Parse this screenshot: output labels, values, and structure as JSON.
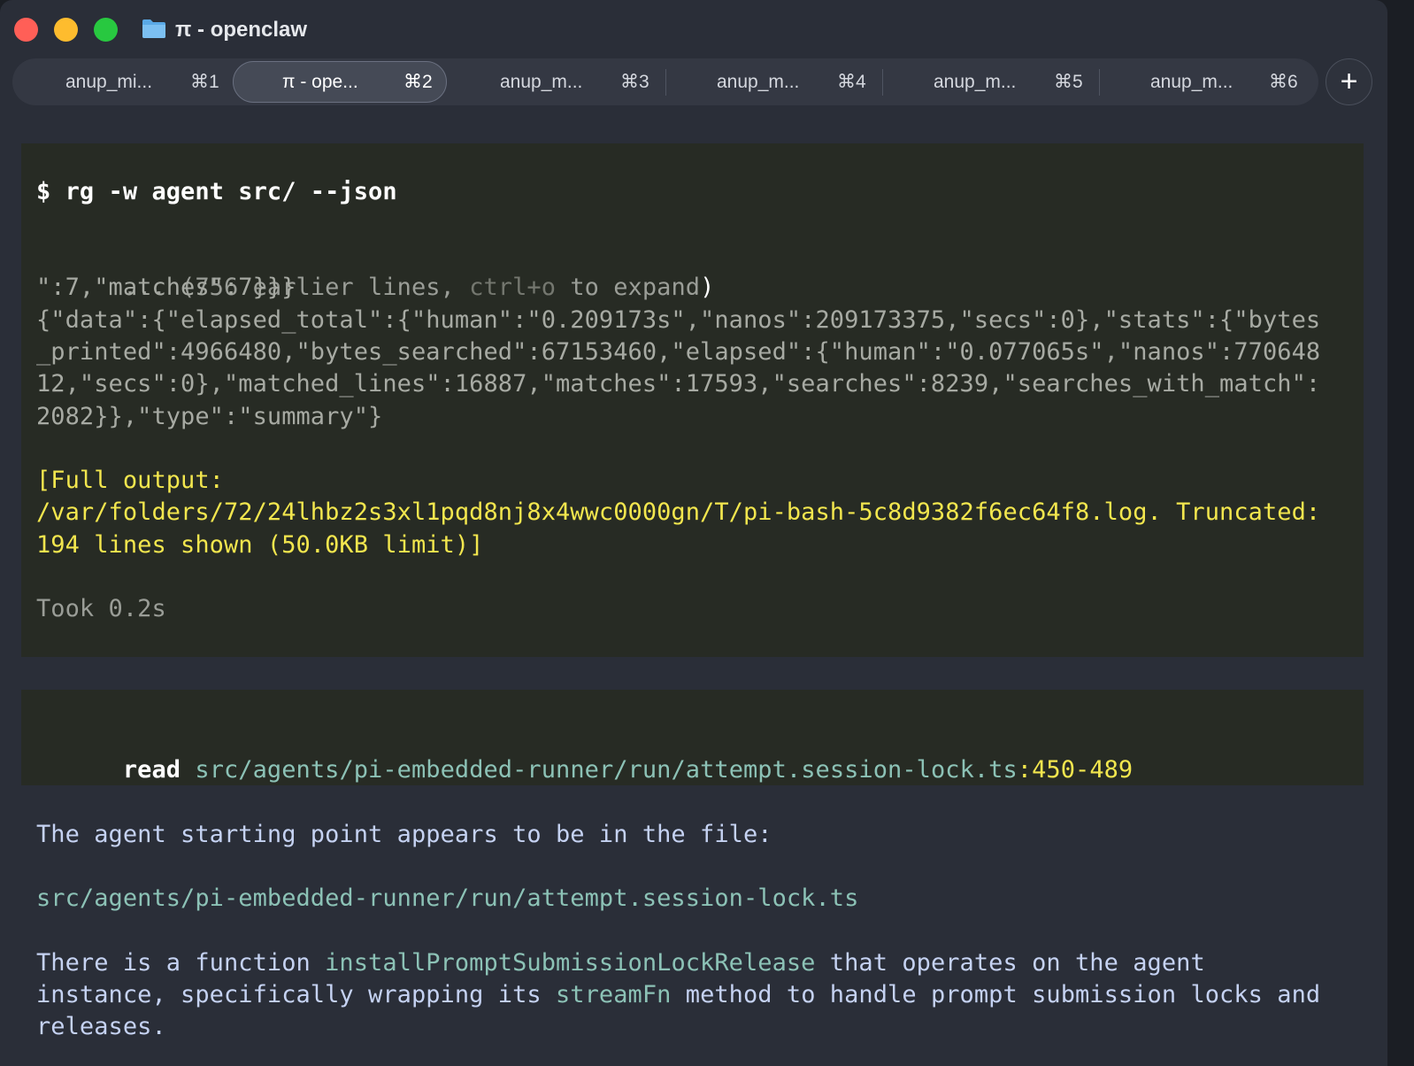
{
  "window": {
    "title": "π - openclaw",
    "folder_icon": "folder-icon"
  },
  "tabs": [
    {
      "label": "anup_mi...",
      "key": "⌘1",
      "active": false
    },
    {
      "label": "π - ope...",
      "key": "⌘2",
      "active": true
    },
    {
      "label": "anup_m...",
      "key": "⌘3",
      "active": false
    },
    {
      "label": "anup_m...",
      "key": "⌘4",
      "active": false
    },
    {
      "label": "anup_m...",
      "key": "⌘5",
      "active": false
    },
    {
      "label": "anup_m...",
      "key": "⌘6",
      "active": false
    }
  ],
  "new_tab_label": "+",
  "bash_block": {
    "command": "$ rg -w agent src/ --json",
    "earlier_prefix": "... (756 earlier lines, ",
    "earlier_shortcut": "ctrl+o",
    "earlier_mid": " to expand",
    "earlier_close": ")",
    "json_lines": [
      "\":7,\"matches\":7}}}",
      "{\"data\":{\"elapsed_total\":{\"human\":\"0.209173s\",\"nanos\":209173375,\"secs\":0},\"stats\":{\"bytes",
      "_printed\":4966480,\"bytes_searched\":67153460,\"elapsed\":{\"human\":\"0.077065s\",\"nanos\":770648",
      "12,\"secs\":0},\"matched_lines\":16887,\"matches\":17593,\"searches\":8239,\"searches_with_match\":",
      "2082}},\"type\":\"summary\"}"
    ],
    "full_output_lines": [
      "[Full output:",
      "/var/folders/72/24lhbz2s3xl1pqd8nj8x4wwc0000gn/T/pi-bash-5c8d9382f6ec64f8.log. Truncated:",
      "194 lines shown (50.0KB limit)]"
    ],
    "took": "Took 0.2s"
  },
  "read_block": {
    "verb": "read",
    "path": "src/agents/pi-embedded-runner/run/attempt.session-lock.ts",
    "range": ":450-489"
  },
  "response": {
    "intro": "The agent starting point appears to be in the file:",
    "file": "src/agents/pi-embedded-runner/run/attempt.session-lock.ts",
    "p1_a": "There is a function ",
    "p1_code": "installPromptSubmissionLockRelease",
    "p1_b": " that operates on the agent",
    "p2_a": "instance, specifically wrapping its ",
    "p2_code": "streamFn",
    "p2_b": " method to handle prompt submission locks and",
    "p3": "releases."
  },
  "colors": {
    "close": "#ff5f57",
    "minimize": "#febc2e",
    "maximize": "#28c840",
    "highlight": "#f2e64e",
    "path": "#8cc2b6",
    "prose": "#c5d2f2"
  }
}
